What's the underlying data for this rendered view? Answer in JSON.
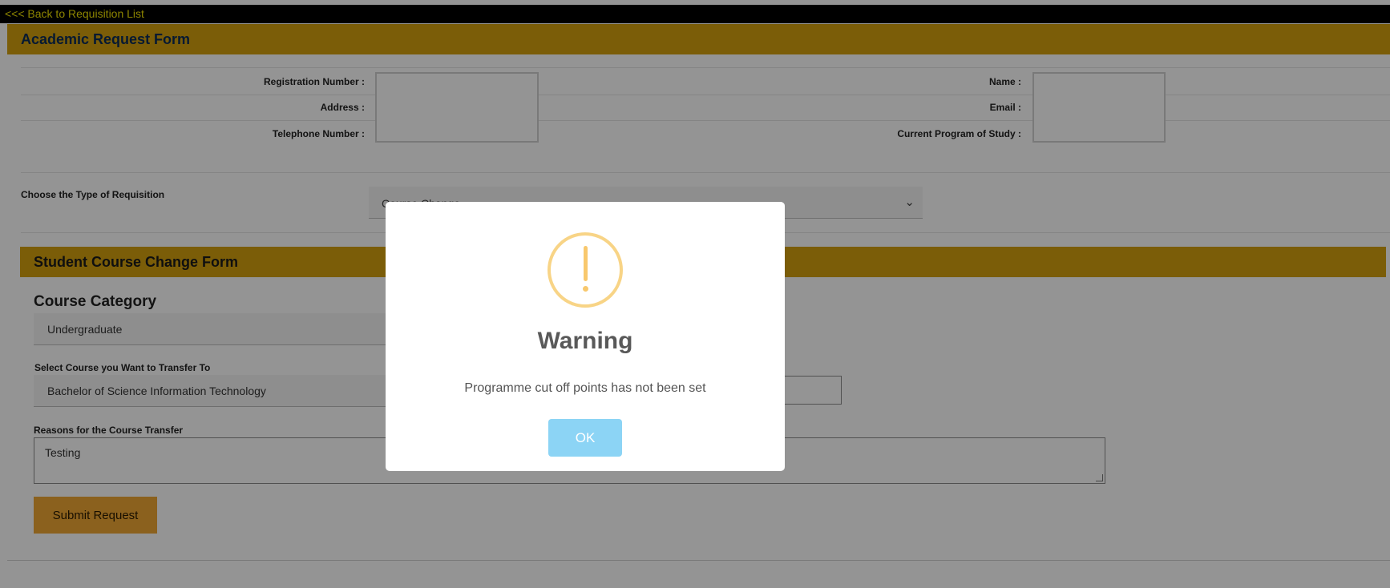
{
  "nav": {
    "back_link": "<<< Back to Requisition List"
  },
  "form": {
    "title": "Academic Request Form",
    "fields": {
      "registration_label": "Registration Number :",
      "address_label": "Address :",
      "telephone_label": "Telephone Number :",
      "name_label": "Name :",
      "email_label": "Email :",
      "program_label": "Current Program of Study :"
    },
    "requisition": {
      "label": "Choose the Type of Requisition",
      "selected": "Course Change"
    }
  },
  "course_change": {
    "title": "Student Course Change Form",
    "category_label": "Course Category",
    "category_value": "Undergraduate",
    "course_label": "Select Course you Want to Transfer To",
    "course_value": "Bachelor of Science Information Technology",
    "reason_label": "Reasons for the Course Transfer",
    "reason_value": "Testing",
    "submit_label": "Submit Request"
  },
  "modal": {
    "icon": "warning-icon",
    "title": "Warning",
    "message": "Programme cut off points has not been set",
    "ok_label": "OK"
  },
  "colors": {
    "header_gold": "#d4a10f",
    "submit_orange": "#f0a834",
    "ok_blue": "#8cd4f5",
    "warning_icon": "#f8d486",
    "back_link": "#f2e300"
  }
}
